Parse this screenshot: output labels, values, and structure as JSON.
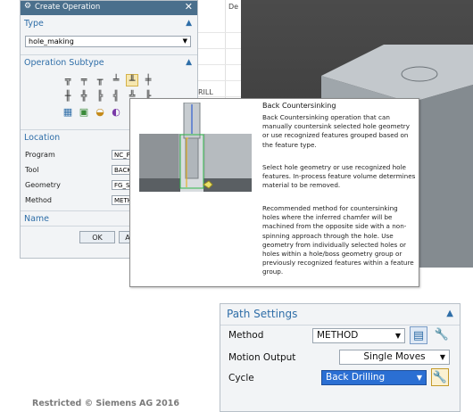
{
  "dialog": {
    "title": "Create Operation",
    "type_section": "Type",
    "type_value": "hole_making",
    "subtype_section": "Operation Subtype",
    "location_section": "Location",
    "location_rows": [
      {
        "label": "Program",
        "value": "NC_P"
      },
      {
        "label": "Tool",
        "value": "BACK"
      },
      {
        "label": "Geometry",
        "value": "FG_ST"
      },
      {
        "label": "Method",
        "value": "METH"
      }
    ],
    "name_section": "Name",
    "ok_label": "OK",
    "apply_label": "A",
    "subtype_icons": [
      "spot-face-icon",
      "drill-icon",
      "counterbore-icon",
      "countersink-icon",
      "back-countersink-icon",
      "bore-icon",
      "ream-icon",
      "tap-icon",
      "thread-mill-icon",
      "hole-mill-icon",
      "chamfer-icon",
      "deburr-icon",
      "feature-group-icon",
      "cylinder-mill-icon",
      "groove-icon",
      "routine-icon"
    ]
  },
  "background": {
    "column_header": "De",
    "row_text": "RILL"
  },
  "tooltip": {
    "title": "Back Countersinking",
    "paragraphs": [
      "Back Countersinking operation that can manually countersink selected hole geometry or use recognized features grouped based on the feature type.",
      "Select hole geometry or use recognized hole features. In-process feature volume determines material to be removed.",
      "Recommended method for countersinking holes where the inferred chamfer will be machined from the opposite side with a non-spinning approach through the hole. Use geometry from individually selected holes or holes within a hole/boss geometry group or previously recognized features within a feature group."
    ]
  },
  "path_settings": {
    "title": "Path Settings",
    "method_label": "Method",
    "method_value": "METHOD",
    "motion_label": "Motion Output",
    "motion_value": "Single Moves",
    "cycle_label": "Cycle",
    "cycle_value": "Back Drilling"
  },
  "colors": {
    "title_bar": "#4a6f8c",
    "section_heading": "#2f6ea8",
    "cycle_highlight": "#2b6fd3",
    "viewport_bg": "#404040",
    "part_gray": "#b8bec3"
  },
  "footer": {
    "copyright": "Restricted © Siemens AG 2016"
  }
}
